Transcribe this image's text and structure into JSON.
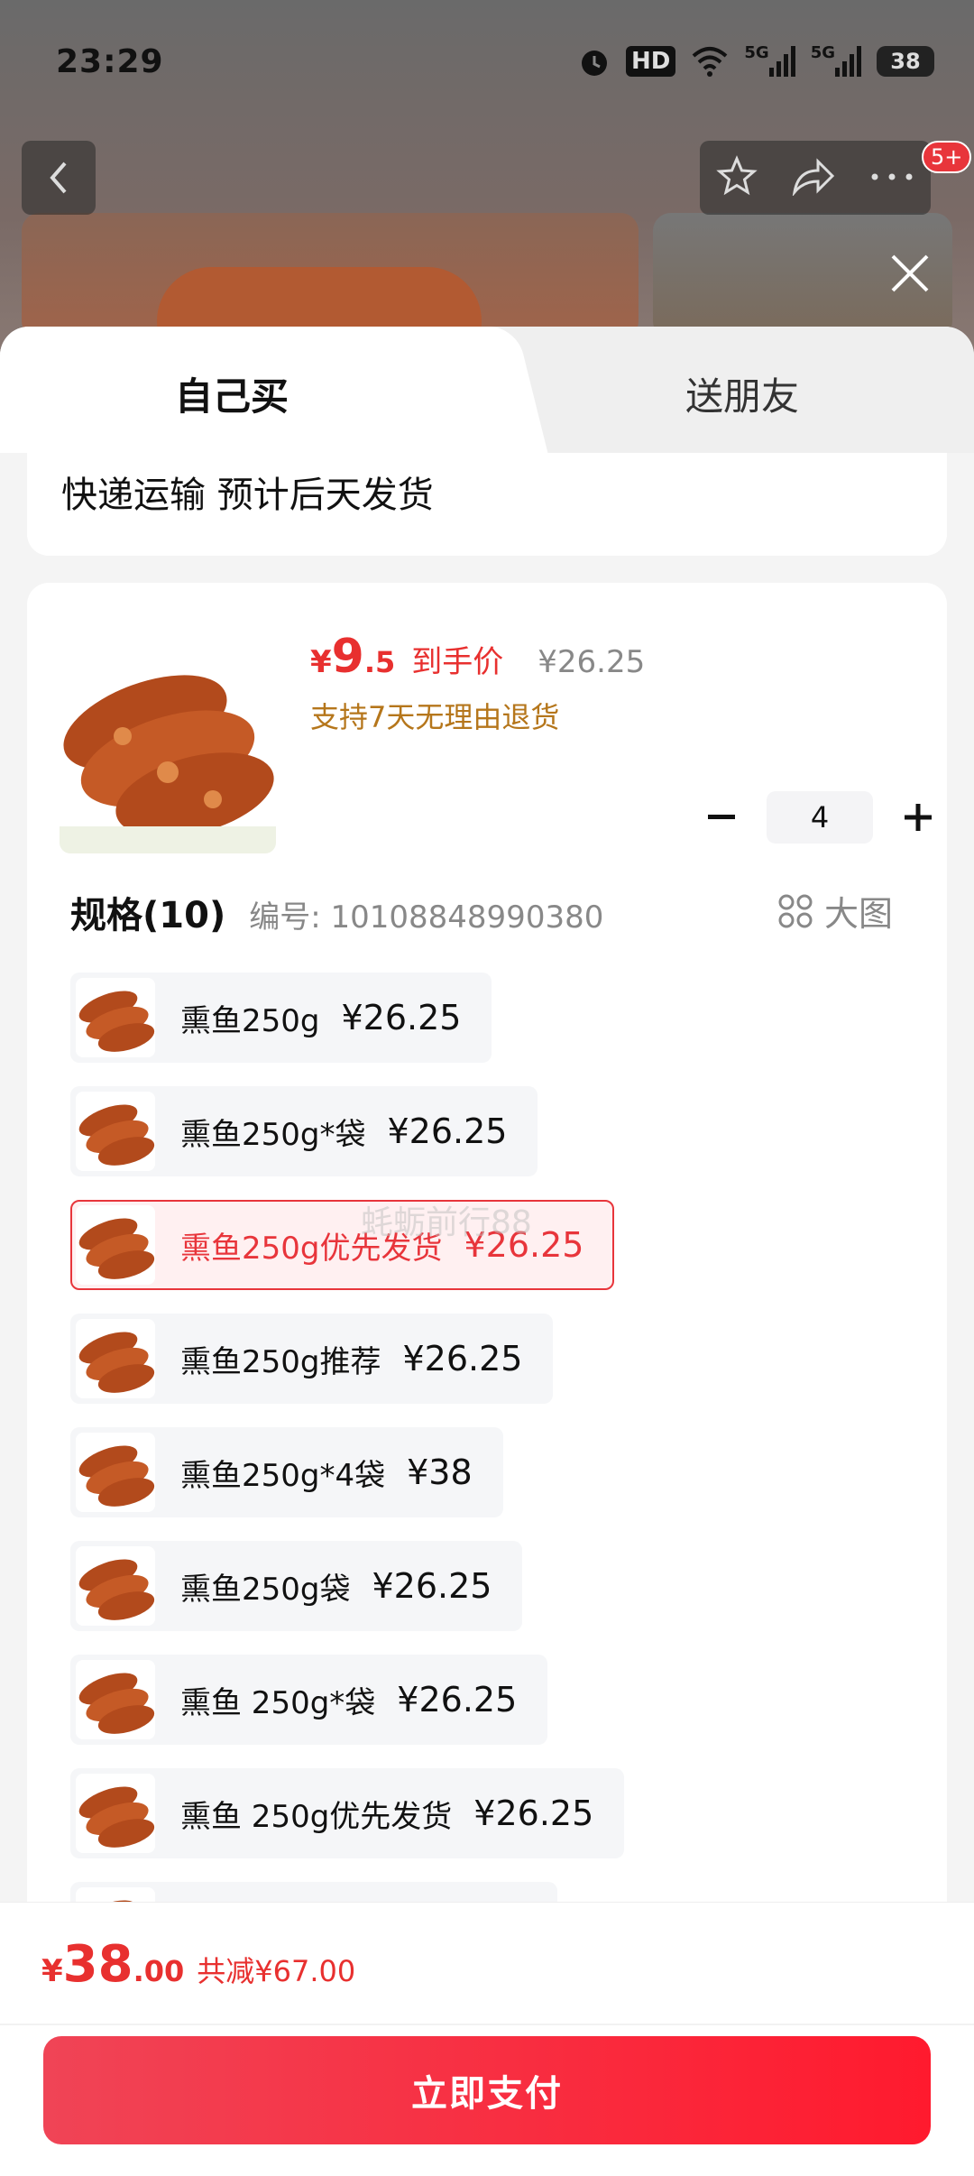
{
  "status_bar": {
    "time": "23:29",
    "hd_label": "HD",
    "net1": "5G",
    "net2": "5G",
    "battery": "38"
  },
  "top_bar": {
    "badge": "5+"
  },
  "tabs": [
    {
      "label": "自己买",
      "active": true
    },
    {
      "label": "送朋友",
      "active": false
    }
  ],
  "delivery": {
    "text": "快递运输 预计后天发货"
  },
  "product": {
    "price_yen": "¥",
    "price_int": "9",
    "price_dec": ".5",
    "price_tag": "到手价",
    "original_price": "¥26.25",
    "return_policy": "支持7天无理由退货",
    "quantity": "4"
  },
  "spec": {
    "title": "规格(10)",
    "code": "编号: 10108848990380",
    "big_image_label": "大图",
    "options": [
      {
        "name": "熏鱼250g",
        "price": "¥26.25",
        "selected": false
      },
      {
        "name": "熏鱼250g*袋",
        "price": "¥26.25",
        "selected": false
      },
      {
        "name": "熏鱼250g优先发货",
        "price": "¥26.25",
        "selected": true
      },
      {
        "name": "熏鱼250g推荐",
        "price": "¥26.25",
        "selected": false
      },
      {
        "name": "熏鱼250g*4袋",
        "price": "¥38",
        "selected": false
      },
      {
        "name": "熏鱼250g袋",
        "price": "¥26.25",
        "selected": false
      },
      {
        "name": "熏鱼 250g*袋",
        "price": "¥26.25",
        "selected": false
      },
      {
        "name": "熏鱼 250g优先发货",
        "price": "¥26.25",
        "selected": false
      }
    ]
  },
  "watermark": "蚝蛎前行88",
  "footer": {
    "total_yen": "¥",
    "total_int": "38",
    "total_dec": ".00",
    "discount": "共减¥67.00",
    "pay_label": "立即支付"
  },
  "colors": {
    "accent": "#e8353b",
    "price_red": "#e8302f",
    "policy_gold": "#b5761b"
  }
}
